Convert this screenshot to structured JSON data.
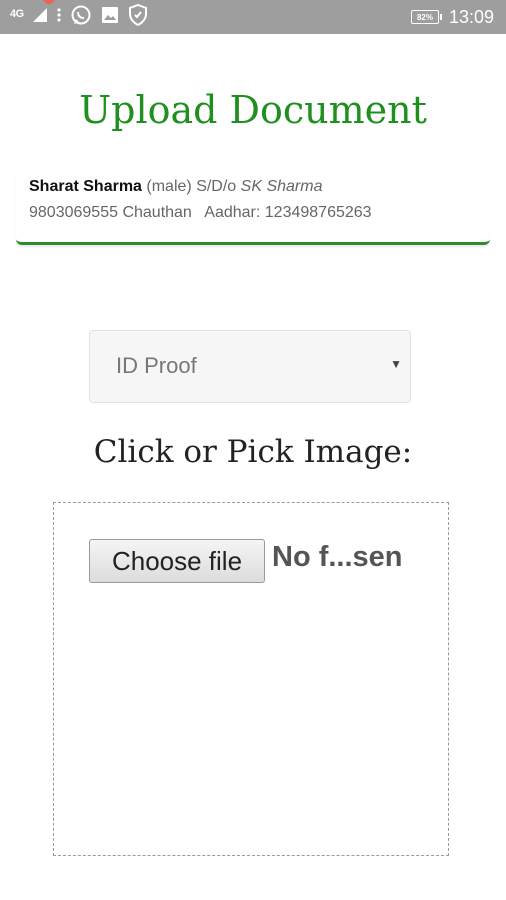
{
  "status_bar": {
    "network": "4G",
    "battery_text": "82%",
    "time": "13:09",
    "icons": [
      "signal-icon",
      "more-vert-icon",
      "whatsapp-icon",
      "image-icon",
      "shield-icon",
      "battery-icon"
    ]
  },
  "page": {
    "title": "Upload Document"
  },
  "person": {
    "name": "Sharat Sharma",
    "gender": "(male)",
    "relation": "S/D/o",
    "parent": "SK Sharma",
    "phone": "9803069555",
    "location": "Chauthan",
    "aadhar_label": "Aadhar:",
    "aadhar_number": "123498765263"
  },
  "document_select": {
    "selected": "ID Proof"
  },
  "upload": {
    "label": "Click or Pick Image:",
    "button_label": "Choose file",
    "file_status": "No f...sen"
  },
  "colors": {
    "accent_green": "#1f8f1f",
    "statusbar_bg": "#9e9e9e"
  }
}
